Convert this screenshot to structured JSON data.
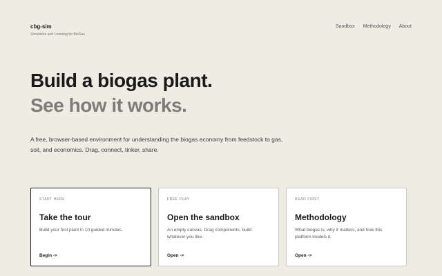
{
  "brand": {
    "name": "cbg-sim",
    "tagline": "Simulation and Learning for BioGas"
  },
  "nav": {
    "items": [
      "Sandbox",
      "Methodology",
      "About"
    ]
  },
  "hero": {
    "title": "Build a biogas plant.",
    "subtitle": "See how it works.",
    "description": "A free, browser-based environment for understanding the biogas economy from feedstock to gas, soil, and economics. Drag, connect, tinker, share."
  },
  "cards": [
    {
      "eyebrow": "START HERE",
      "title": "Take the tour",
      "description": "Build your first plant in 10 guided minutes.",
      "link": "Begin ->"
    },
    {
      "eyebrow": "FREE PLAY",
      "title": "Open the sandbox",
      "description": "An empty canvas. Drag components; build whatever you like.",
      "link": "Open ->"
    },
    {
      "eyebrow": "READ FIRST",
      "title": "Methodology",
      "description": "What biogas is, why it matters, and how this platform models it.",
      "link": "Open ->"
    }
  ],
  "colors": {
    "background": "#efece3",
    "card_background": "#ffffff",
    "title_text": "#1a1a1a",
    "subtitle_text": "#7e7c78"
  }
}
